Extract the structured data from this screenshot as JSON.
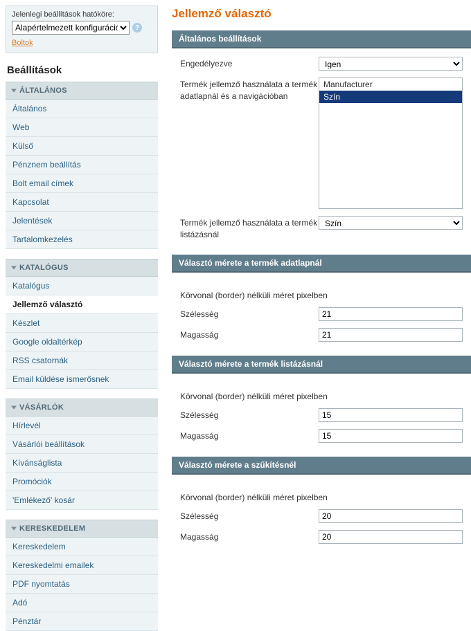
{
  "scope": {
    "label": "Jelenlegi beállítások hatóköre:",
    "value": "Alapértelmezett konfiguráció",
    "stores_link": "Boltok"
  },
  "sidebar_title": "Beállítások",
  "nav": {
    "group0": {
      "title": "ÁLTALÁNOS",
      "items": [
        "Általános",
        "Web",
        "Külső",
        "Pénznem beállítás",
        "Bolt email címek",
        "Kapcsolat",
        "Jelentések",
        "Tartalomkezelés"
      ]
    },
    "group1": {
      "title": "KATALÓGUS",
      "items": [
        "Katalógus",
        "Jellemző választó",
        "Készlet",
        "Google oldaltérkép",
        "RSS csatornák",
        "Email küldése ismerősnek"
      ],
      "active_index": 1
    },
    "group2": {
      "title": "VÁSÁRLÓK",
      "items": [
        "Hírlevél",
        "Vásárlói beállítások",
        "Kívánságlista",
        "Promóciók",
        "'Emlékező' kosár"
      ]
    },
    "group3": {
      "title": "KERESKEDELEM",
      "items": [
        "Kereskedelem",
        "Kereskedelmi emailek",
        "PDF nyomtatás",
        "Adó",
        "Pénztár"
      ]
    }
  },
  "page_title": "Jellemző választó",
  "sections": {
    "general": {
      "title": "Általános beállítások",
      "enabled_label": "Engedélyezve",
      "enabled_value": "Igen",
      "attr_use_label": "Termék jellemző használata a termék adatlapnál és a navigációban",
      "attr_options": [
        "Manufacturer",
        "Szín"
      ],
      "attr_selected_index": 1,
      "attr_list_label": "Termék jellemző használata a termék listázásnál",
      "attr_list_value": "Szín"
    },
    "size_product": {
      "title": "Választó mérete a termék adatlapnál",
      "note": "Körvonal (border) nélküli méret pixelben",
      "width_label": "Szélesség",
      "width_value": "21",
      "height_label": "Magasság",
      "height_value": "21"
    },
    "size_listing": {
      "title": "Választó mérete a termék listázásnál",
      "note": "Körvonal (border) nélküli méret pixelben",
      "width_label": "Szélesség",
      "width_value": "15",
      "height_label": "Magasság",
      "height_value": "15"
    },
    "size_filter": {
      "title": "Választó mérete a szűkítésnél",
      "note": "Körvonal (border) nélküli méret pixelben",
      "width_label": "Szélesség",
      "width_value": "20",
      "height_label": "Magasság",
      "height_value": "20"
    }
  }
}
